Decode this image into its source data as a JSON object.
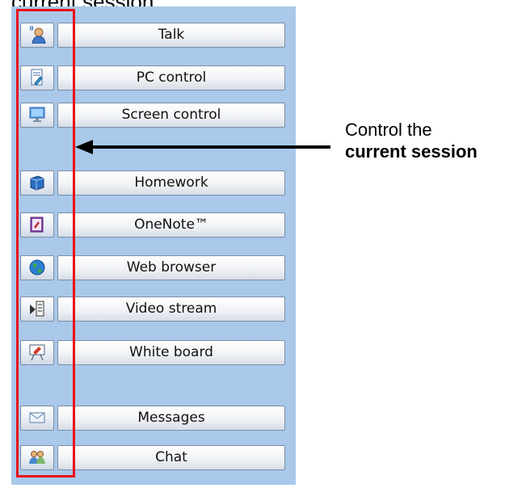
{
  "caption_top": "current session.",
  "sidebar": {
    "group1": [
      {
        "label": "Talk",
        "icon": "talk-icon"
      },
      {
        "label": "PC control",
        "icon": "pc-control-icon"
      },
      {
        "label": "Screen control",
        "icon": "screen-control-icon"
      }
    ],
    "group2": [
      {
        "label": "Homework",
        "icon": "homework-icon"
      },
      {
        "label": "OneNote™",
        "icon": "onenote-icon"
      },
      {
        "label": "Web browser",
        "icon": "globe-icon"
      },
      {
        "label": "Video stream",
        "icon": "video-stream-icon"
      },
      {
        "label": "White board",
        "icon": "whiteboard-icon"
      }
    ],
    "group3": [
      {
        "label": "Messages",
        "icon": "envelope-icon"
      },
      {
        "label": "Chat",
        "icon": "chat-icon"
      }
    ]
  },
  "annotation": {
    "line1": "Control the",
    "line2": "current session"
  },
  "colors": {
    "panel_bg": "#a9c8ea",
    "highlight_border": "#e8101a",
    "arrow": "#000000"
  }
}
